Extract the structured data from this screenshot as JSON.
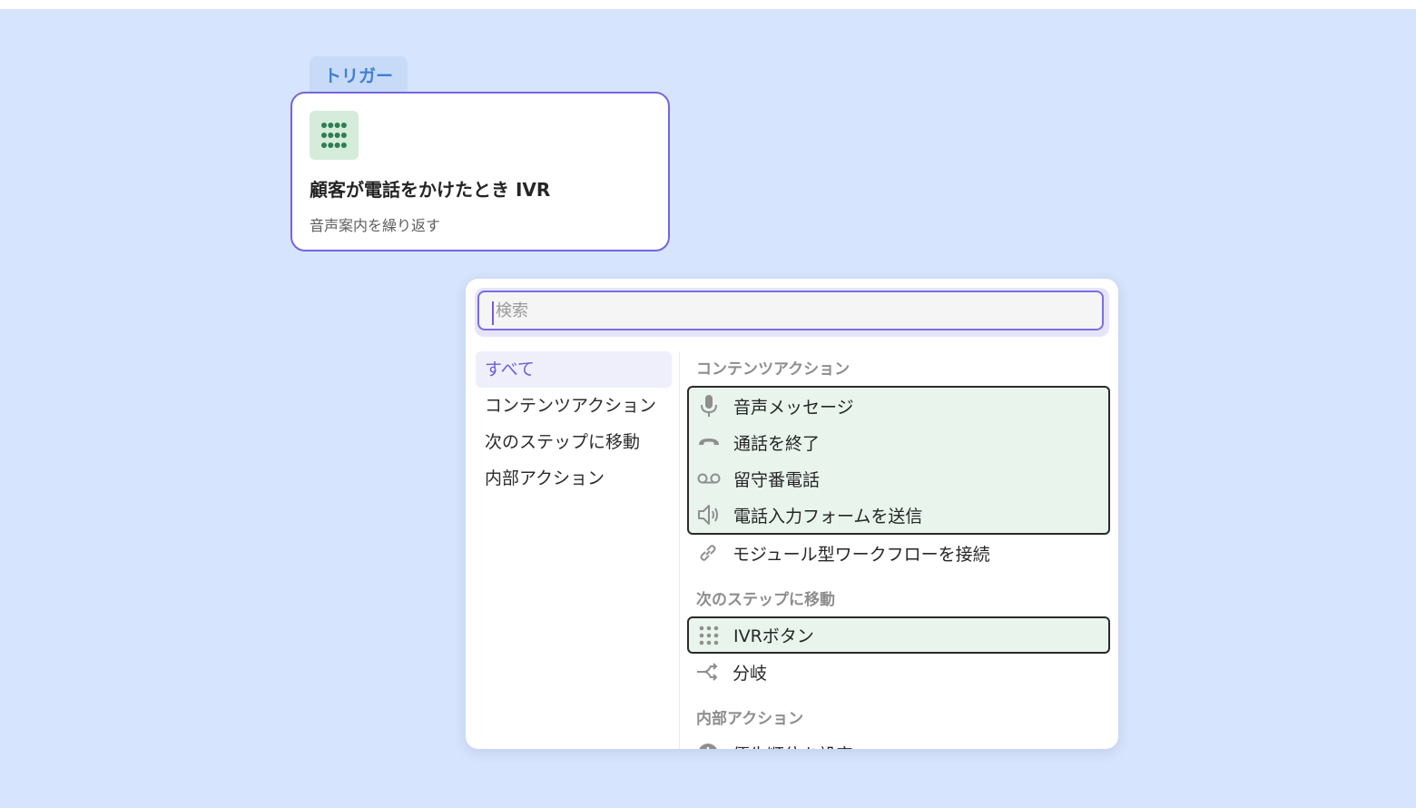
{
  "trigger": {
    "tab_label": "トリガー",
    "title": "顧客が電話をかけたとき IVR",
    "subtitle": "音声案内を繰り返す",
    "icon": "dialpad-icon"
  },
  "picker": {
    "search": {
      "placeholder": "検索",
      "value": ""
    },
    "categories": [
      {
        "label": "すべて",
        "active": true
      },
      {
        "label": "コンテンツアクション",
        "active": false
      },
      {
        "label": "次のステップに移動",
        "active": false
      },
      {
        "label": "内部アクション",
        "active": false
      }
    ],
    "sections": [
      {
        "label": "コンテンツアクション",
        "items": [
          {
            "label": "音声メッセージ",
            "icon": "microphone-icon",
            "highlighted": true
          },
          {
            "label": "通話を終了",
            "icon": "hang-up-icon",
            "highlighted": true
          },
          {
            "label": "留守番電話",
            "icon": "voicemail-icon",
            "highlighted": true
          },
          {
            "label": "電話入力フォームを送信",
            "icon": "speaker-icon",
            "highlighted": true
          },
          {
            "label": "モジュール型ワークフローを接続",
            "icon": "link-icon",
            "highlighted": false
          }
        ]
      },
      {
        "label": "次のステップに移動",
        "items": [
          {
            "label": "IVRボタン",
            "icon": "dialpad-icon",
            "highlighted": true
          },
          {
            "label": "分岐",
            "icon": "branch-icon",
            "highlighted": false
          }
        ]
      },
      {
        "label": "内部アクション",
        "items": [
          {
            "label": "優先順位を設定",
            "icon": "priority-icon",
            "highlighted": false
          }
        ]
      }
    ]
  },
  "colors": {
    "background": "#d6e4fd",
    "accent": "#7465e0",
    "highlight_fill": "#e8f4ec",
    "trigger_icon": "#2f7d52"
  }
}
